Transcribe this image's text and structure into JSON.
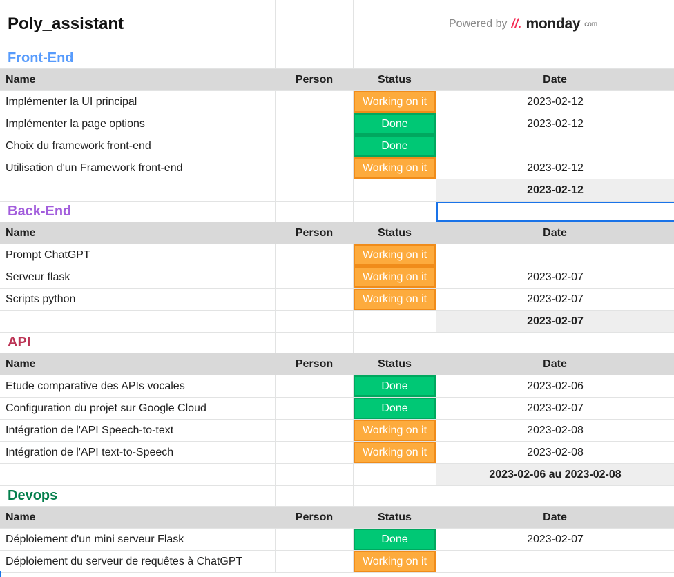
{
  "title": "Poly_assistant",
  "powered": {
    "text": "Powered by",
    "logo_mark": "//.",
    "logo_word": "monday",
    "logo_suffix": "com"
  },
  "columns": {
    "name": "Name",
    "person": "Person",
    "status": "Status",
    "date": "Date"
  },
  "colors": {
    "working": "#fdab3d",
    "done": "#00c875",
    "header_bg": "#d9d9d9",
    "selection": "#1a73e8"
  },
  "groups": [
    {
      "name": "Front-End",
      "color": "#579bfc",
      "rows": [
        {
          "name": "Implémenter la UI principal",
          "status": "Working on it",
          "state": "working",
          "date": "2023-02-12"
        },
        {
          "name": "Implémenter la page options",
          "status": "Done",
          "state": "done",
          "date": "2023-02-12"
        },
        {
          "name": "Choix du framework front-end",
          "status": "Done",
          "state": "done",
          "date": ""
        },
        {
          "name": "Utilisation d'un Framework front-end",
          "status": "Working on it",
          "state": "working",
          "date": "2023-02-12"
        }
      ],
      "summary": "2023-02-12"
    },
    {
      "name": "Back-End",
      "color": "#a25ddc",
      "rows": [
        {
          "name": "Prompt ChatGPT",
          "status": "Working on it",
          "state": "working",
          "date": ""
        },
        {
          "name": "Serveur flask",
          "status": "Working on it",
          "state": "working",
          "date": "2023-02-07"
        },
        {
          "name": "Scripts python",
          "status": "Working on it",
          "state": "working",
          "date": "2023-02-07"
        }
      ],
      "summary": "2023-02-07"
    },
    {
      "name": "API",
      "color": "#bb3354",
      "rows": [
        {
          "name": "Etude comparative des APIs vocales",
          "status": "Done",
          "state": "done",
          "date": "2023-02-06"
        },
        {
          "name": "Configuration du projet sur Google Cloud",
          "status": "Done",
          "state": "done",
          "date": "2023-02-07"
        },
        {
          "name": "Intégration de l'API Speech-to-text",
          "status": "Working on it",
          "state": "working",
          "date": "2023-02-08"
        },
        {
          "name": "Intégration de l'API text-to-Speech",
          "status": "Working on it",
          "state": "working",
          "date": "2023-02-08"
        }
      ],
      "summary": "2023-02-06 au 2023-02-08"
    },
    {
      "name": "Devops",
      "color": "#037f4c",
      "rows": [
        {
          "name": "Déploiement d'un mini serveur Flask",
          "status": "Done",
          "state": "done",
          "date": "2023-02-07"
        },
        {
          "name": "Déploiement du serveur de requêtes à ChatGPT",
          "status": "Working on it",
          "state": "working",
          "date": ""
        }
      ],
      "summary": null
    }
  ]
}
